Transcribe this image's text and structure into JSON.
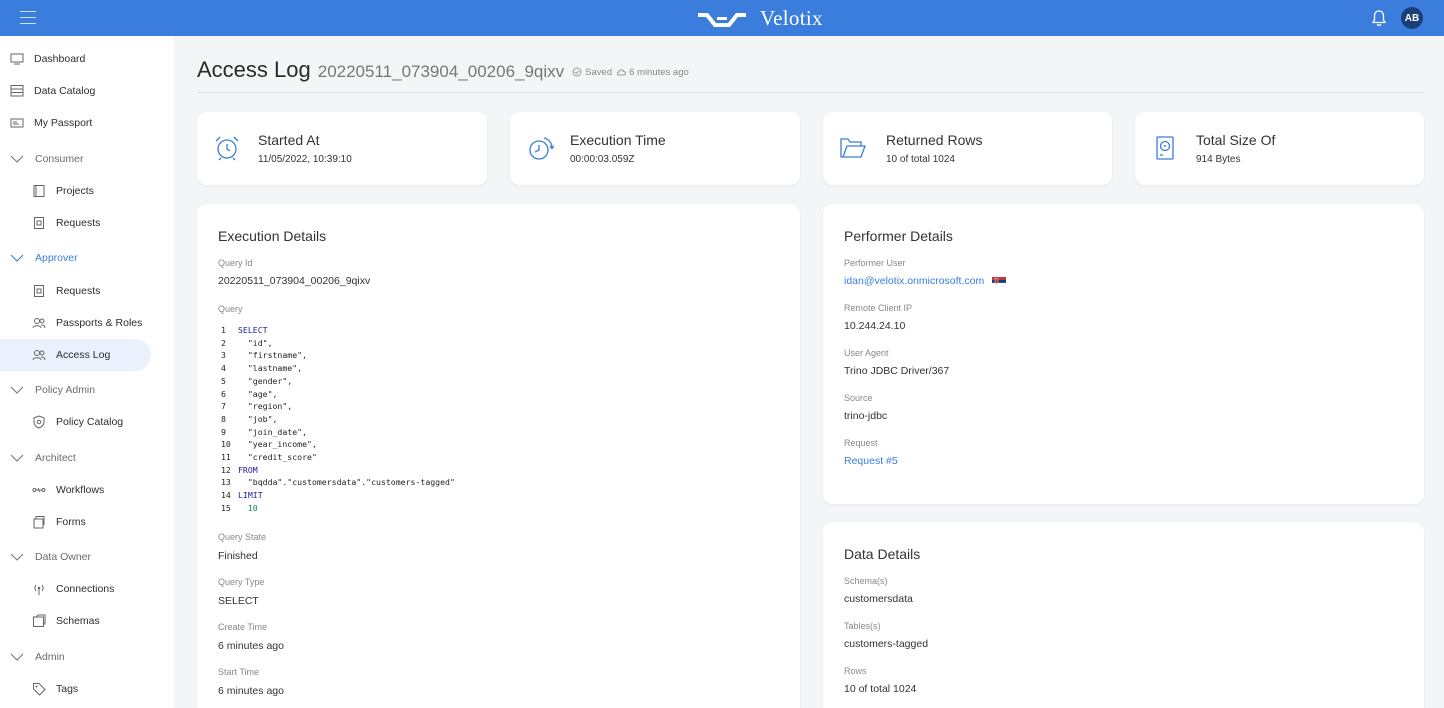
{
  "header": {
    "brand": "Velotix",
    "avatar_initials": "AB"
  },
  "sidebar": {
    "items": [
      {
        "label": "Dashboard",
        "icon": "monitor-icon"
      },
      {
        "label": "Data Catalog",
        "icon": "database-icon"
      },
      {
        "label": "My Passport",
        "icon": "id-card-icon"
      }
    ],
    "groups": [
      {
        "label": "Consumer",
        "items": [
          {
            "label": "Projects",
            "icon": "folder-icon"
          },
          {
            "label": "Requests",
            "icon": "document-icon"
          }
        ]
      },
      {
        "label": "Approver",
        "items": [
          {
            "label": "Requests",
            "icon": "document-icon"
          },
          {
            "label": "Passports & Roles",
            "icon": "users-icon"
          },
          {
            "label": "Access Log",
            "icon": "users-icon"
          }
        ]
      },
      {
        "label": "Policy Admin",
        "items": [
          {
            "label": "Policy Catalog",
            "icon": "policy-icon"
          }
        ]
      },
      {
        "label": "Architect",
        "items": [
          {
            "label": "Workflows",
            "icon": "workflow-icon"
          },
          {
            "label": "Forms",
            "icon": "forms-icon"
          }
        ]
      },
      {
        "label": "Data Owner",
        "items": [
          {
            "label": "Connections",
            "icon": "connection-icon"
          },
          {
            "label": "Schemas",
            "icon": "schema-icon"
          }
        ]
      },
      {
        "label": "Admin",
        "items": [
          {
            "label": "Tags",
            "icon": "tag-icon"
          }
        ]
      }
    ]
  },
  "page": {
    "title": "Access Log",
    "subtitle": "20220511_073904_00206_9qixv",
    "saved_label": "Saved",
    "saved_time": "6 minutes ago"
  },
  "stats": [
    {
      "label": "Started At",
      "value": "11/05/2022, 10:39:10",
      "icon": "alarm-clock-icon"
    },
    {
      "label": "Execution Time",
      "value": "00:00:03.059Z",
      "icon": "timer-icon"
    },
    {
      "label": "Returned Rows",
      "value": "10 of total 1024",
      "icon": "folder-open-icon"
    },
    {
      "label": "Total Size Of",
      "value": "914 Bytes",
      "icon": "disk-icon"
    }
  ],
  "execution": {
    "title": "Execution Details",
    "query_id_label": "Query Id",
    "query_id": "20220511_073904_00206_9qixv",
    "query_label": "Query",
    "query_lines": [
      {
        "n": "1",
        "text": "SELECT",
        "type": "kw"
      },
      {
        "n": "2",
        "text": "  \"id\",",
        "type": "str"
      },
      {
        "n": "3",
        "text": "  \"firstname\",",
        "type": "str"
      },
      {
        "n": "4",
        "text": "  \"lastname\",",
        "type": "str"
      },
      {
        "n": "5",
        "text": "  \"gender\",",
        "type": "str"
      },
      {
        "n": "6",
        "text": "  \"age\",",
        "type": "str"
      },
      {
        "n": "7",
        "text": "  \"region\",",
        "type": "str"
      },
      {
        "n": "8",
        "text": "  \"job\",",
        "type": "str"
      },
      {
        "n": "9",
        "text": "  \"join_date\",",
        "type": "str"
      },
      {
        "n": "10",
        "text": "  \"year_income\",",
        "type": "str"
      },
      {
        "n": "11",
        "text": "  \"credit_score\"",
        "type": "str"
      },
      {
        "n": "12",
        "text": "FROM",
        "type": "kw"
      },
      {
        "n": "13",
        "text": "  \"bqdda\".\"customersdata\".\"customers-tagged\"",
        "type": "str"
      },
      {
        "n": "14",
        "text": "LIMIT",
        "type": "kw"
      },
      {
        "n": "15",
        "text": "  10",
        "type": "num"
      }
    ],
    "state_label": "Query State",
    "state": "Finished",
    "type_label": "Query Type",
    "type": "SELECT",
    "create_label": "Create Time",
    "create": "6 minutes ago",
    "start_label": "Start Time",
    "start": "6 minutes ago"
  },
  "performer": {
    "title": "Performer Details",
    "user_label": "Performer User",
    "user": "idan@velotix.onmicrosoft.com",
    "ip_label": "Remote Client IP",
    "ip": "10.244.24.10",
    "agent_label": "User Agent",
    "agent": "Trino JDBC Driver/367",
    "source_label": "Source",
    "source": "trino-jdbc",
    "request_label": "Request",
    "request": "Request #5"
  },
  "data_details": {
    "title": "Data Details",
    "schema_label": "Schema(s)",
    "schema": "customersdata",
    "tables_label": "Tables(s)",
    "tables": "customers-tagged",
    "rows_label": "Rows",
    "rows": "10 of total 1024"
  },
  "colors": {
    "primary": "#3b7ddd",
    "background": "#f4f5f7",
    "avatar": "#1c3f7a"
  }
}
